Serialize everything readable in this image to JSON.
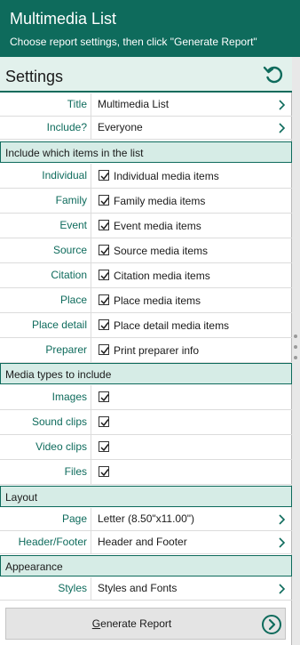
{
  "header": {
    "title": "Multimedia List",
    "subtitle": "Choose report settings, then click \"Generate Report\""
  },
  "settings": {
    "label": "Settings",
    "reset_icon": "reset-icon"
  },
  "rows_top": [
    {
      "label": "Title",
      "value": "Multimedia List"
    },
    {
      "label": "Include?",
      "value": "Everyone"
    }
  ],
  "sections": {
    "items": "Include which items in the list",
    "media": "Media types to include",
    "layout": "Layout",
    "appearance": "Appearance"
  },
  "items": [
    {
      "label": "Individual",
      "text": "Individual media items",
      "checked": true
    },
    {
      "label": "Family",
      "text": "Family media items",
      "checked": true
    },
    {
      "label": "Event",
      "text": "Event media items",
      "checked": true
    },
    {
      "label": "Source",
      "text": "Source media items",
      "checked": true
    },
    {
      "label": "Citation",
      "text": "Citation media items",
      "checked": true
    },
    {
      "label": "Place",
      "text": "Place media items",
      "checked": true
    },
    {
      "label": "Place detail",
      "text": "Place detail media items",
      "checked": true
    },
    {
      "label": "Preparer",
      "text": "Print preparer info",
      "checked": true
    }
  ],
  "media": [
    {
      "label": "Images",
      "checked": true
    },
    {
      "label": "Sound clips",
      "checked": true
    },
    {
      "label": "Video clips",
      "checked": true
    },
    {
      "label": "Files",
      "checked": true
    }
  ],
  "layout": [
    {
      "label": "Page",
      "value": "Letter (8.50\"x11.00\")"
    },
    {
      "label": "Header/Footer",
      "value": "Header and Footer"
    }
  ],
  "appearance": [
    {
      "label": "Styles",
      "value": "Styles and Fonts"
    }
  ],
  "generate": {
    "first_letter": "G",
    "rest": "enerate Report",
    "icon": "arrow-circle-right-icon"
  },
  "colors": {
    "accent": "#0e6b5c",
    "section_bg": "#d6ece6",
    "settings_bg": "#e2f1ec"
  }
}
